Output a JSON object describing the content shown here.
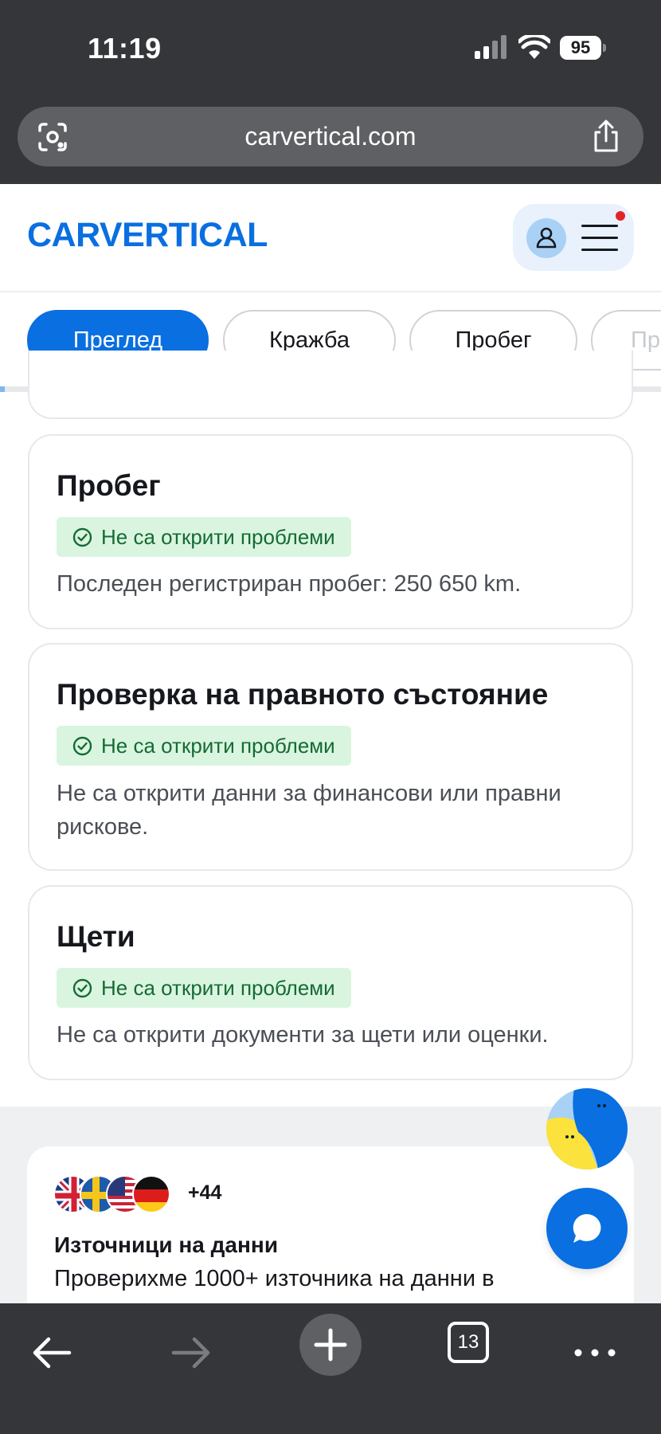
{
  "status_bar": {
    "time": "11:19",
    "battery": "95"
  },
  "url_bar": {
    "url": "carvertical.com"
  },
  "header": {
    "logo_text": "CARVERTICAL"
  },
  "tabs": [
    {
      "label": "Преглед",
      "active": true
    },
    {
      "label": "Кражба",
      "active": false
    },
    {
      "label": "Пробег",
      "active": false
    },
    {
      "label": "Пр",
      "active": false
    }
  ],
  "cards": [
    {
      "title": "Пробег",
      "badge": "Не са открити проблеми",
      "text": "Последен регистриран пробег: 250 650 km."
    },
    {
      "title": "Проверка на правното състояние",
      "badge": "Не са открити проблеми",
      "text": "Не са открити данни за финансови или правни рискове."
    },
    {
      "title": "Щети",
      "badge": "Не са открити проблеми",
      "text": "Не са открити документи за щети или оценки."
    }
  ],
  "sources": {
    "flags": [
      "uk-flag",
      "sweden-flag",
      "usa-flag",
      "germany-flag"
    ],
    "more_count": "+44",
    "title": "Източници на данни",
    "text": "Проверихме 1000+ източника на данни в"
  },
  "bottom_bar": {
    "tab_count": "13"
  },
  "colors": {
    "brand": "#0a6fe0",
    "badge_bg": "#d9f5df",
    "badge_text": "#166a34",
    "chrome": "#34363a"
  }
}
